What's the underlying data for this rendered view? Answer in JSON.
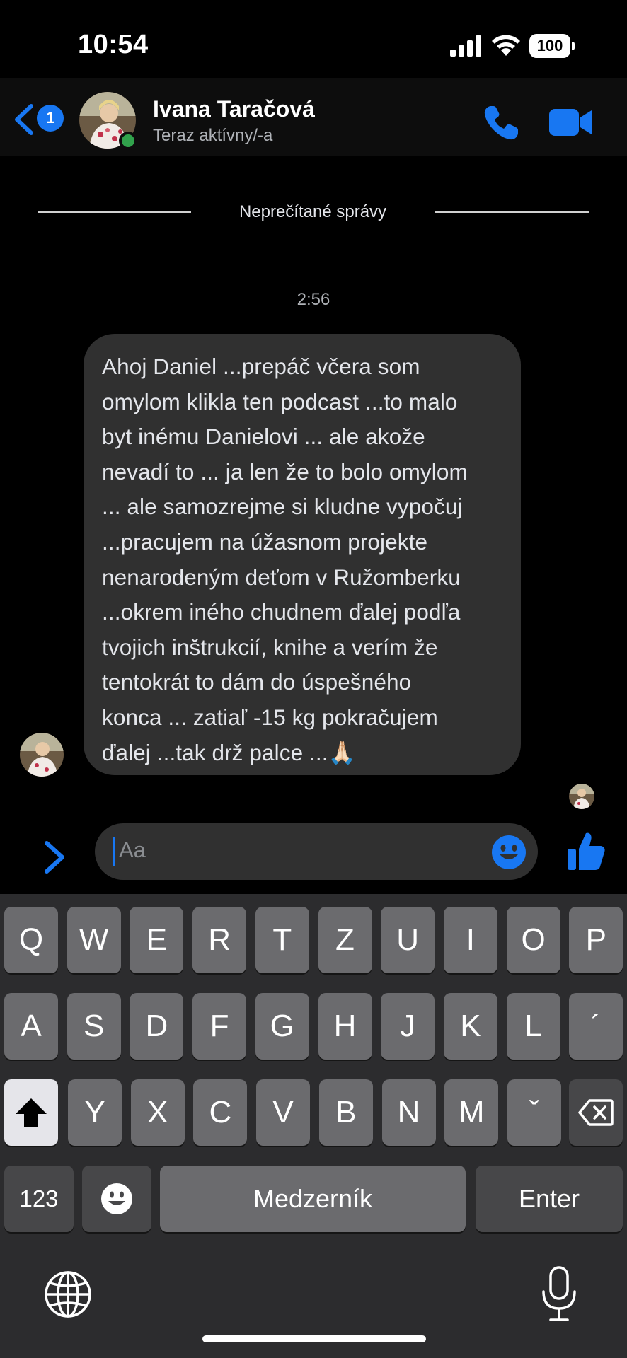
{
  "status_bar": {
    "time": "10:54",
    "battery": "100",
    "icons": [
      "signal-icon",
      "wifi-icon",
      "battery-icon"
    ]
  },
  "header": {
    "back_badge": "1",
    "contact_name": "Ivana Taračová",
    "contact_status": "Teraz aktívny/-a",
    "icons": [
      "back-chevron-icon",
      "phone-icon",
      "video-camera-icon"
    ],
    "accent_color": "#1877f2",
    "online_color": "#31a24c"
  },
  "thread": {
    "divider_label": "Neprečítané správy",
    "timestamp": "2:56",
    "message": {
      "lines": [
        "Ahoj Daniel ...prepáč včera som",
        "omylom klikla ten podcast ...to malo",
        "byt inému Danielovi ... ale akože",
        "nevadí to ... ja len že to bolo omylom",
        "... ale samozrejme si kludne vypočuj",
        "...pracujem na úžasnom projekte",
        "nenarodeným deťom v Ružomberku",
        "...okrem iného chudnem ďalej podľa",
        "tvojich inštrukcií, knihe a verím že",
        "tentokrát to dám do úspešného",
        "konca ... zatiaľ -15 kg pokračujem",
        "ďalej ...tak drž palce ...🙏🏻"
      ]
    }
  },
  "composer": {
    "placeholder": "Aa",
    "icons": [
      "chevron-right-icon",
      "emoji-icon",
      "thumbs-up-icon"
    ]
  },
  "keyboard": {
    "row1": [
      "Q",
      "W",
      "E",
      "R",
      "T",
      "Z",
      "U",
      "I",
      "O",
      "P"
    ],
    "row2": [
      "A",
      "S",
      "D",
      "F",
      "G",
      "H",
      "J",
      "K",
      "L",
      "´"
    ],
    "row3": [
      "Y",
      "X",
      "C",
      "V",
      "B",
      "N",
      "M",
      "ˇ"
    ],
    "numbers_key": "123",
    "space_key": "Medzerník",
    "enter_key": "Enter",
    "icons": [
      "shift-icon",
      "backspace-icon",
      "emoji-icon",
      "globe-icon",
      "microphone-icon"
    ]
  }
}
